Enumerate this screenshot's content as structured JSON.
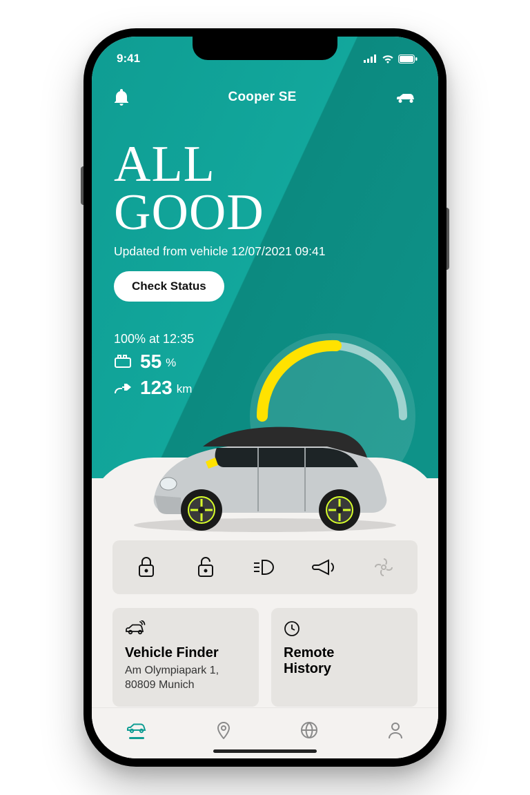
{
  "status_bar": {
    "time": "9:41"
  },
  "appbar": {
    "title": "Cooper SE"
  },
  "hero": {
    "status_line1": "ALL",
    "status_line2": "GOOD",
    "updated": "Updated from vehicle 12/07/2021 09:41",
    "check_status": "Check Status",
    "full_at": "100% at 12:35",
    "battery_pct": "55",
    "battery_unit": "%",
    "range_km": "123",
    "range_unit": "km"
  },
  "cards": {
    "finder": {
      "title": "Vehicle Finder",
      "addr1": "Am Olympiapark 1,",
      "addr2": "80809 Munich"
    },
    "history": {
      "title1": "Remote",
      "title2": "History"
    }
  },
  "colors": {
    "teal": "#0f9d93",
    "yellow": "#ffe200"
  }
}
